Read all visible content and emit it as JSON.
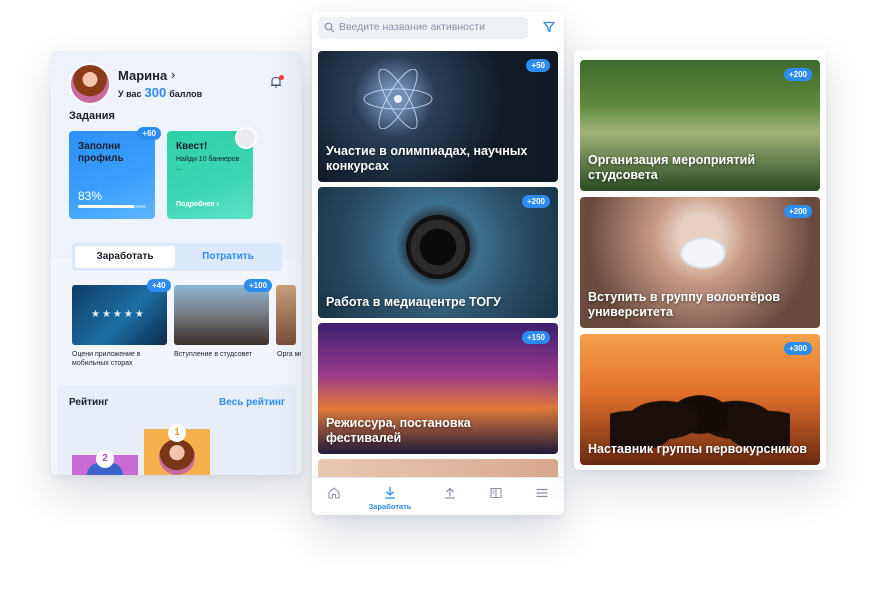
{
  "colors": {
    "accent": "#2d8cf0",
    "text": "#1b1f2a",
    "card_green": "#3dd6b3",
    "card_blue": "#3aa0ff"
  },
  "profile": {
    "name": "Марина",
    "chevron": "›",
    "balance_prefix": "У вас",
    "points": "300",
    "balance_suffix": "баллов"
  },
  "tasks": {
    "heading": "Задания",
    "cards": [
      {
        "title": "Заполни профиль",
        "badge": "+60",
        "progress_label": "83%",
        "progress": 0.83
      },
      {
        "title": "Квест!",
        "subtitle": "Найди 10 баннеров ...",
        "more": "Подробнее ›"
      }
    ]
  },
  "segment": {
    "earn": "Заработать",
    "spend": "Потратить"
  },
  "earn_items": [
    {
      "badge": "+40",
      "caption": "Оцени приложение в мобильных сторах"
    },
    {
      "badge": "+100",
      "caption": "Вступление в студсовет"
    },
    {
      "caption": "Орга мер"
    }
  ],
  "rating": {
    "heading": "Рейтинг",
    "all_link": "Весь рейтинг",
    "places": [
      "1",
      "2"
    ]
  },
  "search": {
    "placeholder": "Введите название активности"
  },
  "activities": [
    {
      "title": "Участие в олимпиадах, научных конкурсах",
      "badge": "+50"
    },
    {
      "title": "Работа в медиацентре ТОГУ",
      "badge": "+200"
    },
    {
      "title": "Режиссура, постановка фестивалей",
      "badge": "+150"
    }
  ],
  "tabbar": {
    "active_label": "Заработать"
  },
  "right_activities": [
    {
      "title": "Организация мероприятий студсовета",
      "badge": "+200"
    },
    {
      "title": "Вступить в группу волонтёров университета",
      "badge": "+200"
    },
    {
      "title": "Наставник группы первокурсников",
      "badge": "+300"
    }
  ],
  "icons": [
    "bell-icon",
    "search-icon",
    "filter-icon",
    "home-icon",
    "download-icon",
    "upload-icon",
    "book-icon",
    "menu-icon"
  ]
}
